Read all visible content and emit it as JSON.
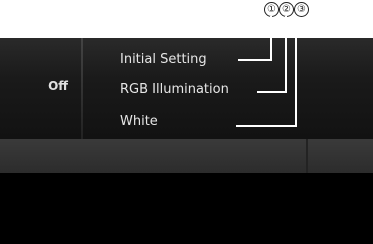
{
  "callouts": [
    "①",
    "②",
    "③"
  ],
  "left_panel": {
    "value": "Off"
  },
  "menu": {
    "items": [
      {
        "label": "Initial Setting"
      },
      {
        "label": "RGB Illumination"
      },
      {
        "label": "White"
      }
    ]
  },
  "colors": {
    "screen_bg": "#000000",
    "text": "#e6e6e6",
    "band": "#333333"
  }
}
